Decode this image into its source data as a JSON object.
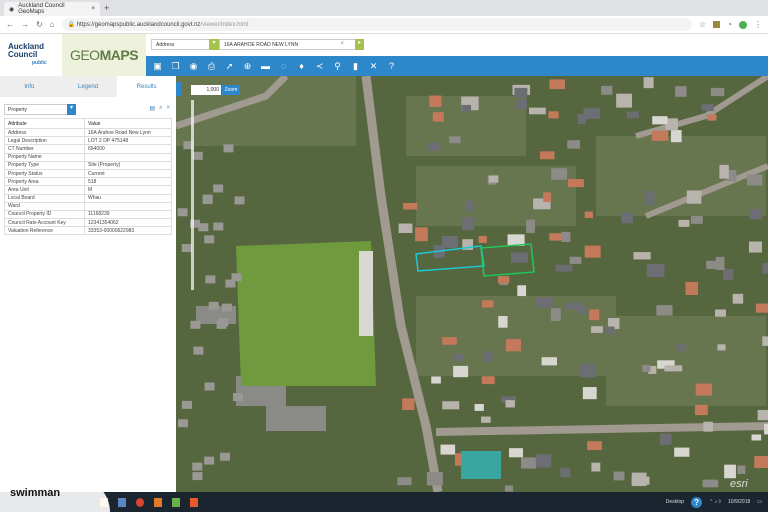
{
  "browser": {
    "tab_title": "Auckland Council GeoMaps",
    "url_host": "https://geomapspublic.aucklandcouncil.govt.nz",
    "url_path": "/viewer/index.html"
  },
  "header": {
    "logo_line1": "Auckland",
    "logo_line2": "Council",
    "logo_sub": "public",
    "app_title_a": "GEO",
    "app_title_b": "MAPS"
  },
  "search": {
    "type": "Address",
    "value": "16A ARAHOE ROAD NEW LYNN",
    "clear": "×"
  },
  "toolbar": {
    "icons": [
      "basemap-icon",
      "layers-icon",
      "eye-icon",
      "print-icon",
      "select-icon",
      "locate-icon",
      "measure-icon",
      "draw-icon",
      "water-icon",
      "share-icon",
      "marker-icon",
      "bookmark-icon",
      "tools-icon",
      "help-icon"
    ],
    "help": "?"
  },
  "panel": {
    "tabs": [
      "Info",
      "Legend",
      "Results"
    ],
    "layer": "Property",
    "columns": [
      "Attribute",
      "Value"
    ],
    "rows": [
      [
        "Address",
        "16A Arahoe Road New Lynn"
      ],
      [
        "Legal Description",
        "LOT 2 DP 475148"
      ],
      [
        "CT Number",
        "654000"
      ],
      [
        "Property Name",
        ""
      ],
      [
        "Property Type",
        "Site (Property)"
      ],
      [
        "Property Status",
        "Current"
      ],
      [
        "Property Area",
        "518"
      ],
      [
        "Area Unit",
        "M"
      ],
      [
        "Local Board",
        "Whau"
      ],
      [
        "Ward",
        ""
      ],
      [
        "Council Property ID",
        "11168239"
      ],
      [
        "Council Rate Account Key",
        "12341354062"
      ],
      [
        "Valuation Reference",
        "33353-00000622983"
      ]
    ]
  },
  "map": {
    "scale": "1,000",
    "zoom_label": "Zoom",
    "attribution": "esri"
  },
  "taskbar": {
    "desktop": "Desktop",
    "date": "10/9/2018"
  },
  "watermark": "swimman"
}
